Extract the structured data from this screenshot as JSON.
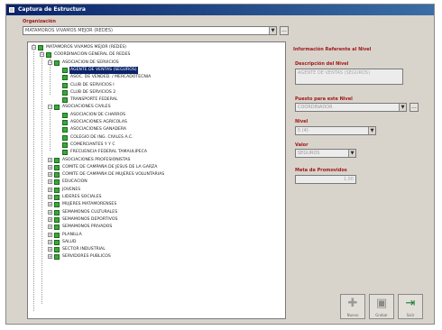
{
  "window": {
    "title": "Captura de Estructura"
  },
  "org": {
    "label": "Organización",
    "value": "MATAMOROS VIVAMOS MEJOR (REDES)",
    "browse": "..."
  },
  "tree": {
    "nodes": [
      {
        "text": "MATAMOROS VIVAMOS MEJOR (REDES)",
        "exp": "−"
      },
      {
        "text": "COORDINACION GENERAL DE REDES",
        "exp": "−"
      },
      {
        "text": "ASOCIACION DE SERVICIOS",
        "exp": "−"
      },
      {
        "text": "AGENTE DE VENTAS (SEGUROS)",
        "selected": true
      },
      {
        "text": "ASOC. DE VENDED. / MERCADOTECNIA"
      },
      {
        "text": "CLUB DE SERVICIOS I"
      },
      {
        "text": "CLUB DE SERVICIOS 2"
      },
      {
        "text": "TRANSPORTE FEDERAL"
      },
      {
        "text": "ASOCIACIONES CIVILES",
        "exp": "−"
      },
      {
        "text": "ASOCIACION DE CHARROS"
      },
      {
        "text": "ASOCIACIONES AGRICOLAS"
      },
      {
        "text": "ASOCIACIONES GANADERA"
      },
      {
        "text": "COLEGIO DE ING. CIVILES A.C."
      },
      {
        "text": "COMERCIANTES Y Y C"
      },
      {
        "text": "FRECUENCIA FEDERAL TAMAULIPECA"
      },
      {
        "text": "ASOCIACIONES PROFESIONISTAS",
        "exp": "+"
      },
      {
        "text": "COMITE DE CAMPAÑA DE JESUS DE LA GARZA",
        "exp": "+"
      },
      {
        "text": "COMITE DE CAMPAÑA DE MUJERES VOLUNTARIAS",
        "exp": "+"
      },
      {
        "text": "EDUCACION",
        "exp": "+"
      },
      {
        "text": "JOVENES",
        "exp": "+"
      },
      {
        "text": "LIDERES SOCIALES",
        "exp": "+"
      },
      {
        "text": "MUJERES MATAMORENSES",
        "exp": "+"
      },
      {
        "text": "SEMAMONOS CULTURALES",
        "exp": "+"
      },
      {
        "text": "SEMAMONOS DEPORTIVOS",
        "exp": "+"
      },
      {
        "text": "SEMAMONOS PRIVADOS",
        "exp": "+"
      },
      {
        "text": "PLANILLA",
        "exp": "+"
      },
      {
        "text": "SALUD",
        "exp": "+"
      },
      {
        "text": "SECTOR INDUSTRIAL",
        "exp": "+"
      },
      {
        "text": "SERVIDORES PUBLICOS",
        "exp": "+"
      }
    ]
  },
  "panel": {
    "heading": "Información Referente al Nivel",
    "desc_label": "Descripción del Nivel",
    "desc_value": "AGENTE DE VENTAS (SEGUROS)",
    "parent_label": "Puesto para este Nivel",
    "parent_value": "COORDINADOR",
    "parent_browse": "...",
    "level_label": "Nivel",
    "level_value": "5 (4)",
    "value_label": "Valor",
    "value_value": "SEGUROS",
    "meta_label": "Meta de Promovidos",
    "meta_value": "1.00"
  },
  "buttons": {
    "new_caption": "Nuevo",
    "save_caption": "Grabar",
    "exit_caption": "Salir"
  },
  "colors": {
    "label": "#a01818",
    "selection": "#0a246a",
    "folder": "#3aa83a"
  }
}
